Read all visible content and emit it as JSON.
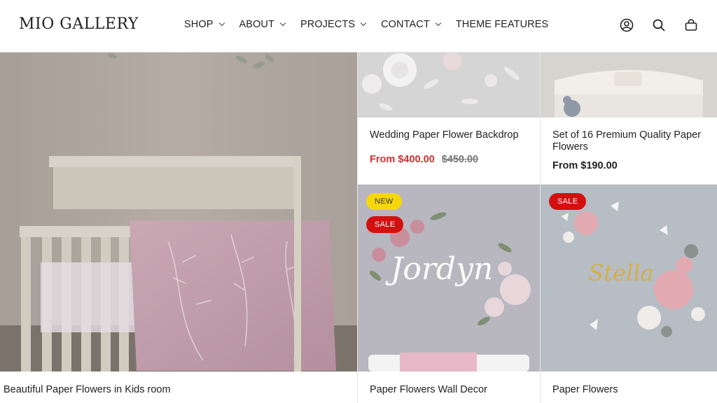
{
  "brand": {
    "logo": "MIO GALLERY"
  },
  "nav": {
    "items": [
      {
        "label": "SHOP",
        "dropdown": true
      },
      {
        "label": "ABOUT",
        "dropdown": true
      },
      {
        "label": "PROJECTS",
        "dropdown": true
      },
      {
        "label": "CONTACT",
        "dropdown": true
      },
      {
        "label": "THEME FEATURES",
        "dropdown": false
      }
    ],
    "icons": [
      "account-icon",
      "search-icon",
      "cart-icon"
    ]
  },
  "products": [
    {
      "title": "Beautiful Paper Flowers in Kids room"
    },
    {
      "title": "Wedding Paper Flower Backdrop",
      "price": "From $400.00",
      "compare_price": "$450.00"
    },
    {
      "title": "Set of 16 Premium Quality Paper Flowers",
      "price": "From $190.00"
    },
    {
      "title": "Paper Flowers Wall Decor",
      "badges": [
        "NEW",
        "SALE"
      ],
      "image_text": "Jordyn"
    },
    {
      "title": "Paper Flowers",
      "badges": [
        "SALE"
      ],
      "image_text": "Stella"
    }
  ],
  "colors": {
    "sale": "#d32f2f",
    "badge_new": "#f5d60c",
    "badge_sale": "#d40f0f"
  }
}
